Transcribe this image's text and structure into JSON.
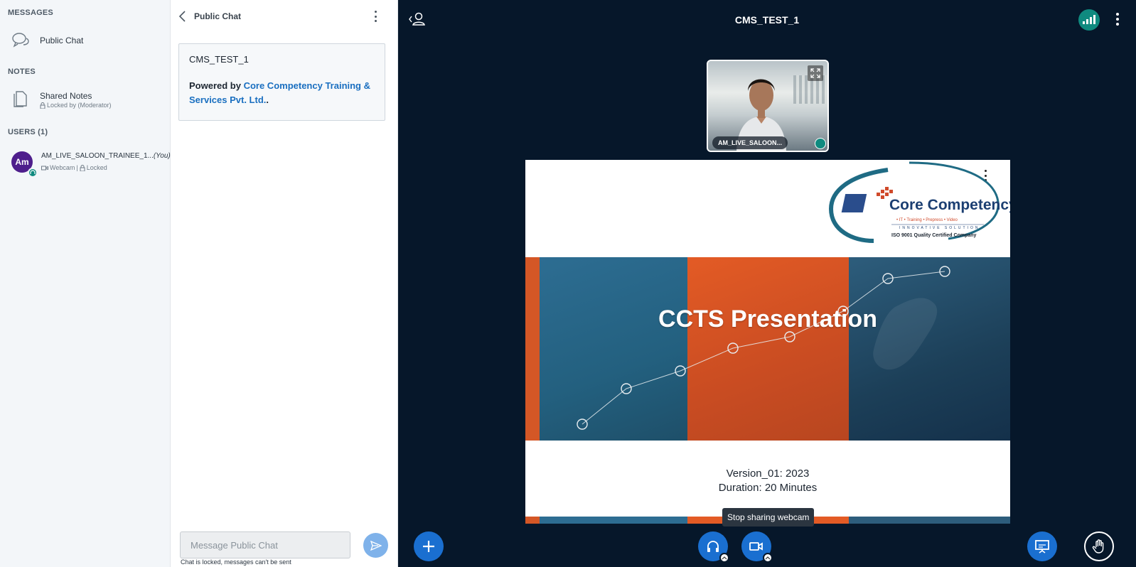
{
  "userlist": {
    "messages_title": "MESSAGES",
    "public_chat_label": "Public Chat",
    "notes_title": "NOTES",
    "shared_notes_label": "Shared Notes",
    "shared_notes_sub": "Locked by (Moderator)",
    "users_title": "USERS (1)",
    "user": {
      "initials": "Am",
      "name": "AM_LIVE_SALOON_TRAINEE_1...",
      "you": "(You)",
      "status_webcam": "Webcam",
      "status_sep": "|",
      "status_locked": "Locked",
      "avatar_color": "#4e1e8c"
    }
  },
  "chat": {
    "title": "Public Chat",
    "welcome_title": "CMS_TEST_1",
    "welcome_prefix": "Powered by ",
    "welcome_link": "Core Competency Training & Services Pvt. Ltd.",
    "welcome_suffix": ".",
    "input_placeholder": "Message Public Chat",
    "locked_notice": "Chat is locked, messages can't be sent"
  },
  "main": {
    "title": "CMS_TEST_1",
    "webcam_label": "AM_LIVE_SALOON...",
    "tooltip": "Stop sharing webcam"
  },
  "slide": {
    "logo_name": "Core Competency",
    "logo_tags": "• IT   • Training   • Prepress   • Video",
    "logo_tagline": "INNOVATIVE SOLUTION",
    "logo_iso": "ISO 9001 Quality Certified Company",
    "heading": "CCTS Presentation",
    "version": "Version_01: 2023",
    "duration": "Duration: 20 Minutes"
  },
  "colors": {
    "accent": "#1a6fd0",
    "audio_badge": "#0f8a7f",
    "link": "#1a6fc0",
    "background": "#06172a"
  }
}
